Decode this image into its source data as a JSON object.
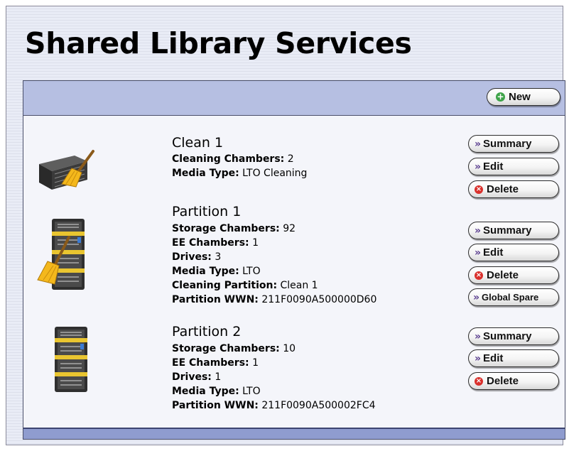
{
  "page": {
    "title": "Shared Library Services"
  },
  "toolbar": {
    "new_label": "New"
  },
  "entries": [
    {
      "name": "Clean 1",
      "icon": "cleaning-library-icon",
      "fields": [
        {
          "label": "Cleaning Chambers:",
          "value": "2"
        },
        {
          "label": "Media Type:",
          "value": "LTO Cleaning"
        }
      ],
      "buttons": {
        "summary": "Summary",
        "edit": "Edit",
        "delete": "Delete"
      }
    },
    {
      "name": "Partition 1",
      "icon": "partition-with-cleaning-icon",
      "fields": [
        {
          "label": "Storage Chambers:",
          "value": "92"
        },
        {
          "label": "EE Chambers:",
          "value": "1"
        },
        {
          "label": "Drives:",
          "value": "3"
        },
        {
          "label": "Media Type:",
          "value": "LTO"
        },
        {
          "label": "Cleaning Partition:",
          "value": "Clean 1"
        },
        {
          "label": "Partition WWN:",
          "value": "211F0090A500000D60"
        }
      ],
      "buttons": {
        "summary": "Summary",
        "edit": "Edit",
        "delete": "Delete",
        "global_spare": "Global Spare"
      }
    },
    {
      "name": "Partition 2",
      "icon": "partition-icon",
      "fields": [
        {
          "label": "Storage Chambers:",
          "value": "10"
        },
        {
          "label": "EE Chambers:",
          "value": "1"
        },
        {
          "label": "Drives:",
          "value": "1"
        },
        {
          "label": "Media Type:",
          "value": "LTO"
        },
        {
          "label": "Partition WWN:",
          "value": "211F0090A500002FC4"
        }
      ],
      "buttons": {
        "summary": "Summary",
        "edit": "Edit",
        "delete": "Delete"
      }
    }
  ],
  "colors": {
    "toolbar": "#b6bfe2",
    "footer": "#8f9ccf",
    "delete_icon": "#d9302c",
    "new_icon": "#3fa44a",
    "chevron": "#5b3f8f"
  }
}
